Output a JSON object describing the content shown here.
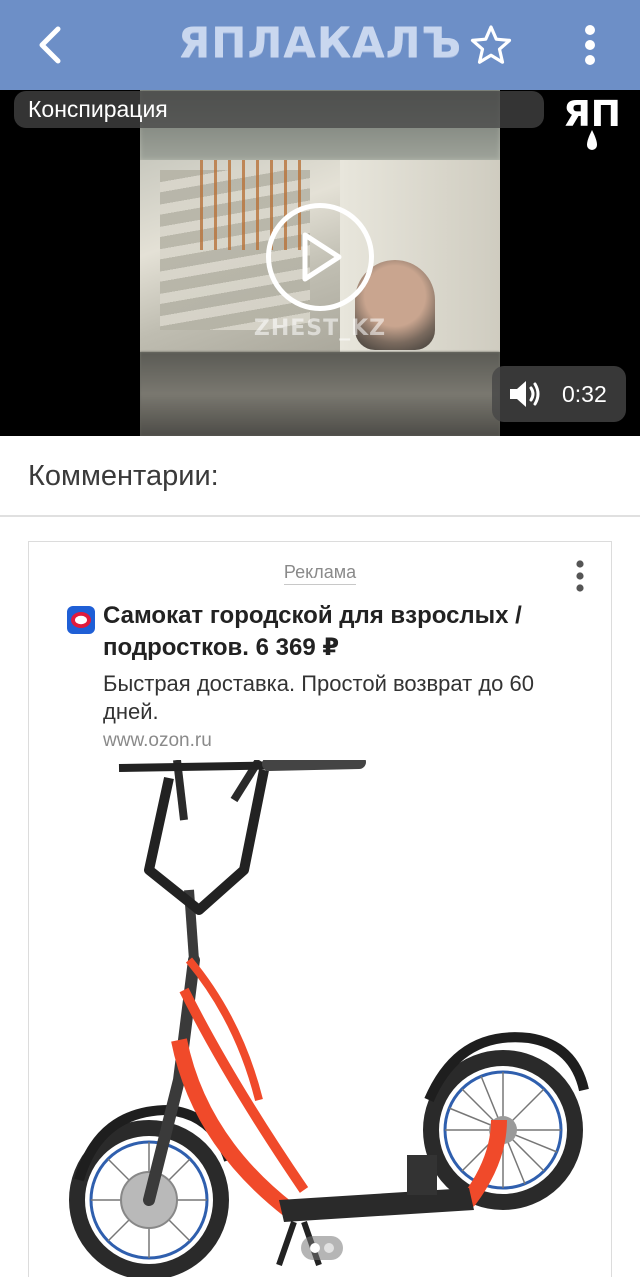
{
  "header": {
    "back_icon": "chevron-left-icon",
    "logo_text": "ЯПЛАКАЛЪ",
    "favorite_icon": "star-outline-icon",
    "menu_icon": "more-vertical-icon",
    "background_color": "#6d8fc7"
  },
  "video": {
    "category": "Конспирация",
    "watermark": "ZHEST_KZ",
    "channel_logo": "ЯП",
    "duration": "0:32",
    "play_icon": "play-icon",
    "volume_icon": "volume-icon"
  },
  "comments": {
    "title": "Комментарии:"
  },
  "ad": {
    "label": "Реклама",
    "menu_icon": "more-vertical-icon",
    "brand_icon": "ozon-logo-icon",
    "title": "Самокат городской для взрослых / подростков. 6 369 ₽",
    "description": "Быстрая доставка. Простой возврат до 60 дней.",
    "url": "www.ozon.ru",
    "image": "scooter-image",
    "carousel_active": 1,
    "carousel_count": 2
  }
}
